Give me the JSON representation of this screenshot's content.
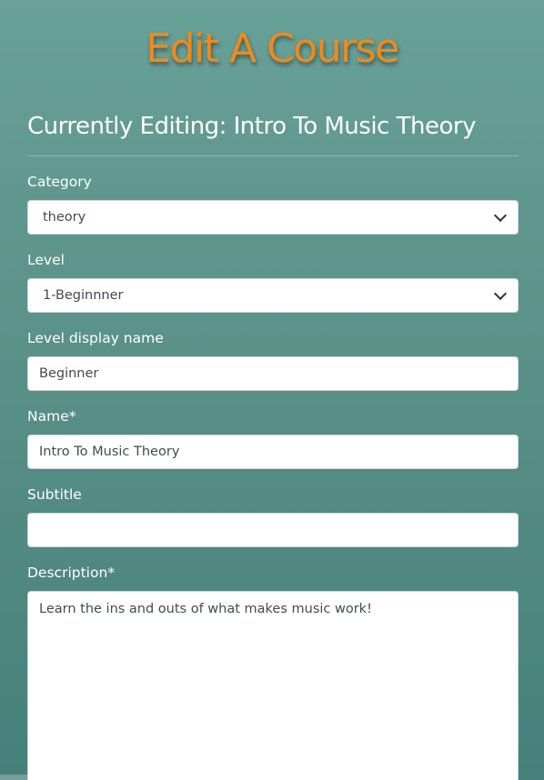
{
  "page": {
    "title": "Edit A Course",
    "editing_heading": "Currently Editing: Intro To Music Theory"
  },
  "form": {
    "category": {
      "label": "Category",
      "value": "theory"
    },
    "level": {
      "label": "Level",
      "value": "1-Beginnner"
    },
    "level_display_name": {
      "label": "Level display name",
      "value": "Beginner"
    },
    "name": {
      "label": "Name*",
      "value": "Intro To Music Theory"
    },
    "subtitle": {
      "label": "Subtitle",
      "value": ""
    },
    "description": {
      "label": "Description*",
      "value": "Learn the ins and outs of what makes music work!"
    }
  },
  "colors": {
    "title": "#f08a1c",
    "background_top": "#68a198",
    "background_bottom": "#45807a"
  }
}
